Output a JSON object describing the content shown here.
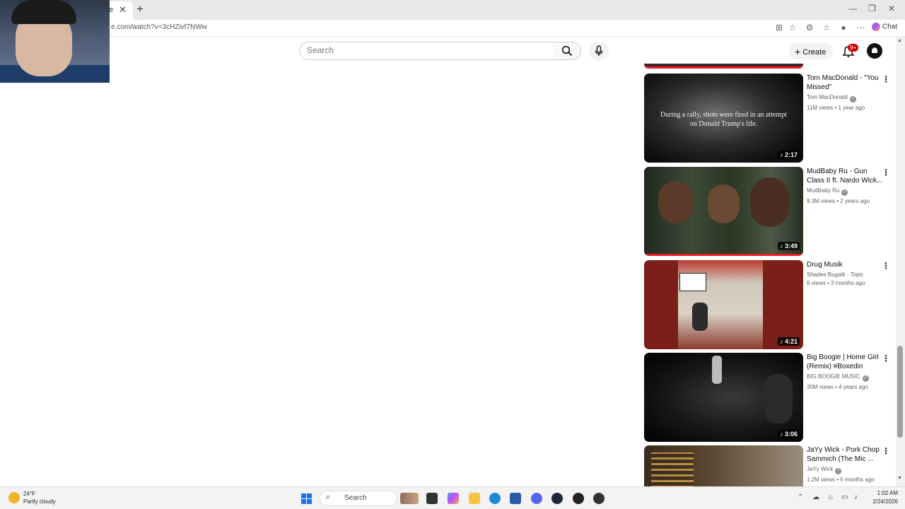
{
  "browser": {
    "tab_title": "e",
    "tab_close": "✕",
    "new_tab": "+",
    "url": "e.com/watch?v=3cHZivf7NWw",
    "chat_label": "Chat",
    "window_controls": [
      "—",
      "❐",
      "✕"
    ]
  },
  "header": {
    "search_placeholder": "Search",
    "create_label": "Create",
    "notification_count": "9+",
    "avatar_glyph": "☗"
  },
  "videos": [
    {
      "title": "Tom MacDonald - \"You Missed\"",
      "channel": "Tom MacDonald",
      "verified": true,
      "stats": "11M views • 1 year ago",
      "duration": "2:17",
      "thumb_caption": "During a rally, shots were fired in an attempt on Donald Trump's life."
    },
    {
      "title": "MudBaby Ru - Gun Class II ft. Nardo Wick...",
      "channel": "MudBaby Ru",
      "verified": true,
      "stats": "9.3M views • 2 years ago",
      "duration": "3:49"
    },
    {
      "title": "Drug Musik",
      "channel": "Shadee Bugatti - Topic",
      "verified": false,
      "stats": "6 views • 3 months ago",
      "duration": "4:21"
    },
    {
      "title": "Big Boogie | Home Girl (Remix) #Boxedin",
      "channel": "BIG BOOGIE MUSIC",
      "verified": true,
      "stats": "30M views • 4 years ago",
      "duration": "3:06"
    },
    {
      "title": "JaYy Wick - Pork Chop Sammich (The Mic ...",
      "channel": "JaYy Wick",
      "verified": true,
      "stats": "1.2M views • 5 months ago",
      "duration": ""
    }
  ],
  "taskbar": {
    "weather_temp": "24°F",
    "weather_desc": "Partly cloudy",
    "search_label": "Search",
    "time": "1:02 AM",
    "date": "2/24/2026"
  },
  "colors": {
    "accent_red": "#e51c23",
    "windows_blue": "#1a73e8"
  }
}
